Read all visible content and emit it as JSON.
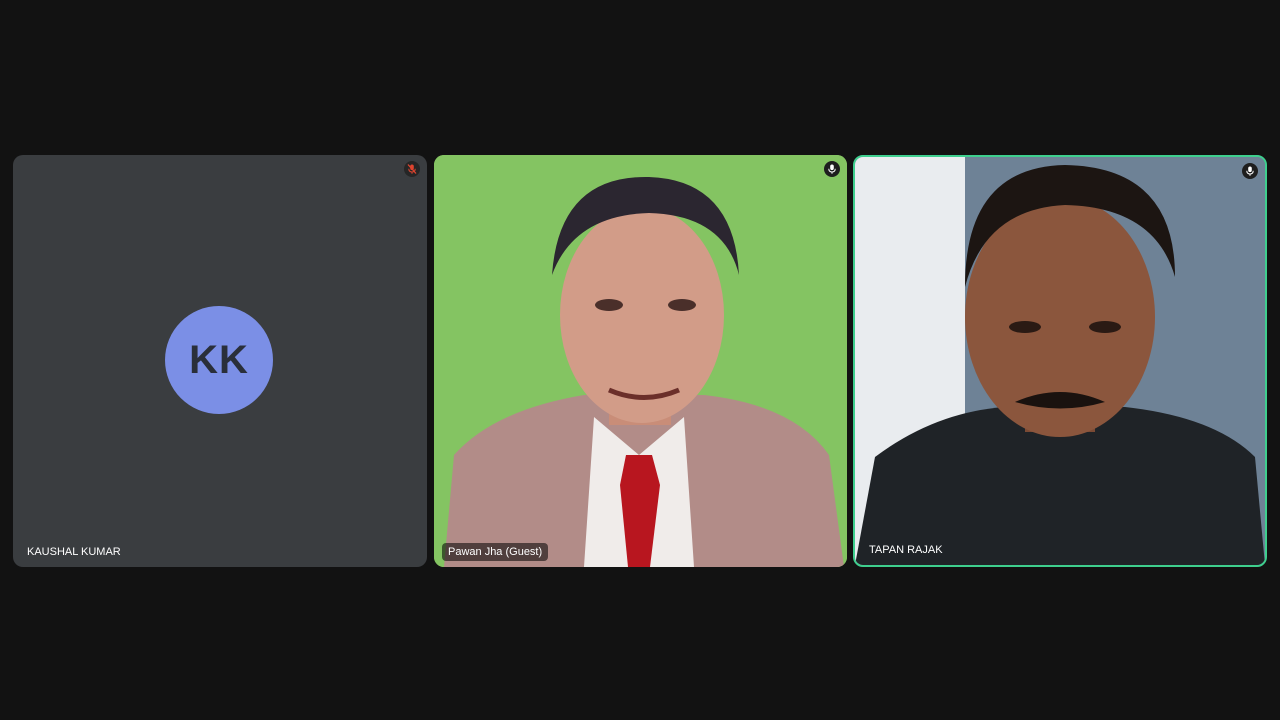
{
  "participants": [
    {
      "name": "KAUSHAL KUMAR",
      "initials": "KK",
      "mic_state": "muted",
      "mic_icon": "mic-off-icon",
      "avatar_color": "#7b8fe6",
      "tile_color": "#3a3d40"
    },
    {
      "name": "Pawan Jha (Guest)",
      "mic_state": "on",
      "mic_icon": "mic-icon",
      "background_color": "#7fc15e"
    },
    {
      "name": "TAPAN RAJAK",
      "mic_state": "on",
      "mic_icon": "mic-icon",
      "active_speaker": true,
      "highlight_color": "#3ecf8e"
    }
  ],
  "colors": {
    "page_background": "#121212",
    "muted_mic": "#e0442f",
    "label_text": "#ffffff"
  }
}
